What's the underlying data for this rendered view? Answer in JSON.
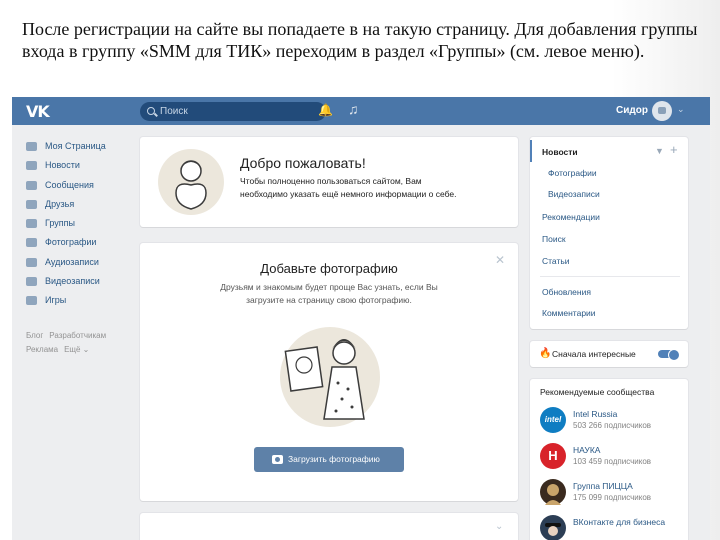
{
  "caption": "После регистрации на сайте вы попадаете в на такую страницу. Для добавления группы входа в группу «SMM для ТИК» переходим в раздел «Группы» (см. левое меню).",
  "topbar": {
    "logo": "VK",
    "search_placeholder": "Поиск",
    "username": "Сидор"
  },
  "leftnav": {
    "items": [
      {
        "label": "Моя Страница",
        "icon": "home-icon"
      },
      {
        "label": "Новости",
        "icon": "news-icon"
      },
      {
        "label": "Сообщения",
        "icon": "messages-icon"
      },
      {
        "label": "Друзья",
        "icon": "friends-icon"
      },
      {
        "label": "Группы",
        "icon": "groups-icon"
      },
      {
        "label": "Фотографии",
        "icon": "camera-icon"
      },
      {
        "label": "Аудиозаписи",
        "icon": "music-icon"
      },
      {
        "label": "Видеозаписи",
        "icon": "video-icon"
      },
      {
        "label": "Игры",
        "icon": "gamepad-icon"
      }
    ],
    "extra_row1": [
      "Блог",
      "Разработчикам"
    ],
    "extra_row2": [
      "Реклама",
      "Ещё ⌄"
    ]
  },
  "welcome": {
    "title": "Добро пожаловать!",
    "text": "Чтобы полноценно пользоваться сайтом, Вам необходимо указать ещё немного информации о себе."
  },
  "photo_card": {
    "title": "Добавьте фотографию",
    "text": "Друзьям и знакомым будет проще Вас узнать, если Вы загрузите на страницу свою фотографию.",
    "button": "Загрузить фотографию"
  },
  "right_menu": {
    "items": [
      "Новости",
      "Фотографии",
      "Видеозаписи",
      "Рекомендации",
      "Поиск",
      "Статьи",
      "Обновления",
      "Комментарии"
    ]
  },
  "interest": {
    "label": "Сначала интересные",
    "enabled": true
  },
  "communities": {
    "title": "Рекомендуемые сообщества",
    "items": [
      {
        "name": "Intel Russia",
        "subs": "503 266 подписчиков",
        "color": "#0f7dc2",
        "logo": "intel"
      },
      {
        "name": "НАУКА",
        "subs": "103 459 подписчиков",
        "color": "#d8232a",
        "logo": "Н"
      },
      {
        "name": "Группа ПИЦЦА",
        "subs": "175 099 подписчиков",
        "color": "#3a2a1e",
        "logo": ""
      },
      {
        "name": "ВКонтакте для бизнеса",
        "subs": "",
        "color": "#2c3e55",
        "logo": ""
      }
    ]
  },
  "colors": {
    "header": "#4a76a8",
    "link": "#2a5885",
    "button": "#5e81a8",
    "background": "#edeef0"
  }
}
